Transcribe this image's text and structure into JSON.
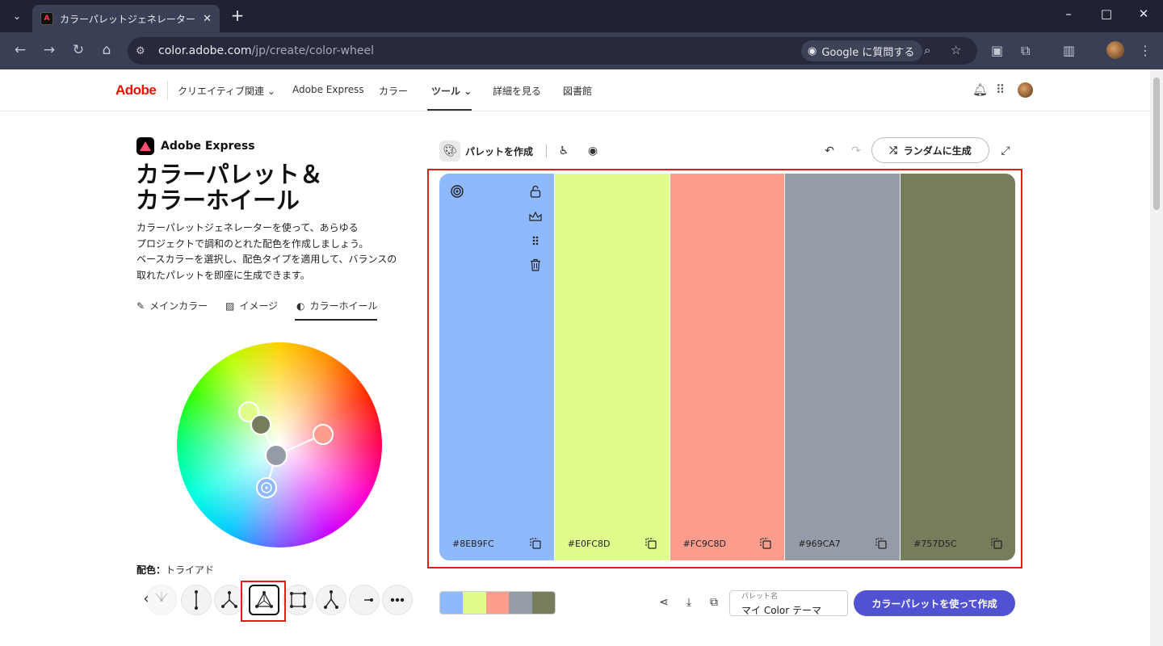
{
  "browser": {
    "tab_title": "カラーパレットジェネレーター：カラーホ",
    "url_host": "color.adobe.com",
    "url_path": "/jp/create/color-wheel",
    "google_ask_label": "Google に質問する"
  },
  "site_header": {
    "logo": "Adobe",
    "nav": [
      {
        "label": "クリエイティブ関連"
      },
      {
        "label": "Adobe Express"
      },
      {
        "label": "カラー"
      },
      {
        "label": "ツール"
      },
      {
        "label": "詳細を見る"
      },
      {
        "label": "図書館"
      }
    ],
    "active_nav": "ツール"
  },
  "left_panel": {
    "brand": "Adobe Express",
    "title_line1": "カラーパレット＆",
    "title_line2": "カラーホイール",
    "description": [
      "カラーパレットジェネレーターを使って、あらゆる",
      "プロジェクトで調和のとれた配色を作成しましょう。",
      "ベースカラーを選択し、配色タイプを適用して、バランスの",
      "取れたパレットを即座に生成できます。"
    ],
    "mode_tabs": [
      {
        "label": "メインカラー",
        "icon": "eyedropper-icon"
      },
      {
        "label": "イメージ",
        "icon": "image-icon"
      },
      {
        "label": "カラーホイール",
        "icon": "color-wheel-icon"
      }
    ],
    "active_mode": "カラーホイール",
    "harmony_label": "配色：",
    "harmony_value": "トライアド",
    "harmony_options": [
      "analogous",
      "complementary",
      "split-complementary",
      "triad",
      "square",
      "compound",
      "shades",
      "more"
    ],
    "active_harmony": "triad"
  },
  "toolbar": {
    "create_palette_label": "パレットを作成",
    "random_label": "ランダムに生成"
  },
  "palette": {
    "swatches": [
      {
        "hex": "#8EB9FC",
        "color": "#8EB9FC"
      },
      {
        "hex": "#E0FC8D",
        "color": "#E0FC8D"
      },
      {
        "hex": "#FC9C8D",
        "color": "#FC9C8D"
      },
      {
        "hex": "#969CA7",
        "color": "#969CA7"
      },
      {
        "hex": "#757D5C",
        "color": "#757D5C"
      }
    ]
  },
  "bottom_bar": {
    "palette_name_label": "パレット名",
    "palette_name_value": "マイ Color テーマ",
    "create_button_label": "カラーパレットを使って作成"
  },
  "colors": {
    "adobe_red": "#eb1000",
    "cta_purple": "#5151d3",
    "highlight_red": "#e31b1b"
  }
}
